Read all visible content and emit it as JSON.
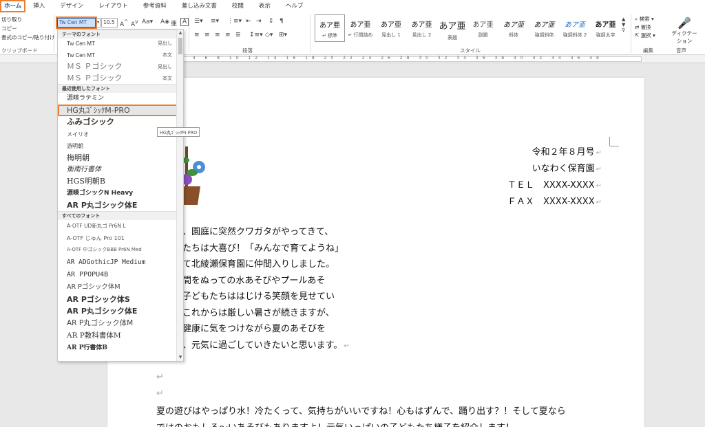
{
  "tabs": [
    "ホーム",
    "挿入",
    "デザイン",
    "レイアウト",
    "参考資料",
    "差し込み文書",
    "校閲",
    "表示",
    "ヘルプ"
  ],
  "clipboard": {
    "cut": "切り取り",
    "copy": "コピー",
    "format_copy": "書式のコピー/貼り付け",
    "label": "クリップボード"
  },
  "font": {
    "name": "Tw Cen MT",
    "size": "10.5"
  },
  "paragraph_label": "段落",
  "styles_label": "スタイル",
  "styles": [
    {
      "preview": "あア亜",
      "name": "↵ 標準"
    },
    {
      "preview": "あア亜",
      "name": "↵ 行間詰め"
    },
    {
      "preview": "あア亜",
      "name": "見出し 1"
    },
    {
      "preview": "あア亜",
      "name": "見出し 2"
    },
    {
      "preview": "あア亜",
      "name": "表題"
    },
    {
      "preview": "あア亜",
      "name": "副題"
    },
    {
      "preview": "あア亜",
      "name": "斜体"
    },
    {
      "preview": "あア亜",
      "name": "強調斜体"
    },
    {
      "preview": "あア亜",
      "name": "強調斜体 2"
    },
    {
      "preview": "あア亜",
      "name": "強調太字"
    }
  ],
  "editing": {
    "find": "検索",
    "replace": "置換",
    "select": "選択",
    "label": "編集"
  },
  "dictation": {
    "label": "ディクテーション",
    "group": "音声"
  },
  "ruler": "2 4 6 8 10 12 14 16 18 20 22 24 26 28 30 32 34 36 38 40 42 44 46 48",
  "dropdown": {
    "theme_header": "テーマのフォント",
    "theme_fonts": [
      {
        "name": "Tw Cen MT",
        "tag": "見出し"
      },
      {
        "name": "Tw Cen MT",
        "tag": "本文"
      },
      {
        "name": "ＭＳ Ｐゴシック",
        "tag": "見出し"
      },
      {
        "name": "ＭＳ Ｐゴシック",
        "tag": "本文"
      }
    ],
    "recent_header": "最近使用したフォント",
    "recent_fonts": [
      "源暎ラテミン",
      "HG丸ｺﾞｼｯｸM-PRO",
      "ふみゴシック",
      "メイリオ",
      "游明朝",
      "梅明朝",
      "衡南行書体",
      "HGS明朝B",
      "源暎ゴシックN Heavy",
      "AR P丸ゴシック体E"
    ],
    "all_header": "すべてのフォント",
    "all_fonts": [
      "A-OTF UD新丸ゴ Pr6N L",
      "A-OTF じゅん Pro 101",
      "A-OTF 中ゴシックBBB Pr6N Med",
      "AR ADGothicJP Medium",
      "AR PPOPU4B",
      "AR Pゴシック体M",
      "AR Pゴシック体S",
      "AR P丸ゴシック体E",
      "AR P丸ゴシック体M",
      "AR P教科書体M",
      "AR P行書体B"
    ]
  },
  "tooltip": "HG丸ｺﾞｼｯｸM-PRO",
  "letter": {
    "date": "令和２年８月号",
    "sender": "いなわく保育園",
    "tel": "ＴＥＬ　XXXX-XXXX",
    "fax": "ＦＡＸ　XXXX-XXXX",
    "lines": [
      "、園庭に突然クワガタがやってきて、",
      "たちは大喜び！「みんなで育てようね」",
      "て北綾瀬保育園に仲間入りしました。",
      "間をぬっての水あそびやプールあそ",
      "子どもたちははじける笑顔を見せてい",
      "これからは厳しい暑さが続きますが、",
      "健康に気をつけながら夏のあそびを",
      "、元気に過ごしていきたいと思います。"
    ],
    "para2_line1": "夏の遊びはやっぱり水！冷たくって、気持ちがいいですね！心もはずんで、踊り出す？！そして夏なら",
    "para2_line2": "ではのおもしろ～いあそびもありますよ！元気いっぱいの子どもたち様子を紹介します！"
  },
  "accent_color": "#ed7d31",
  "brand_color": "#2b579a"
}
